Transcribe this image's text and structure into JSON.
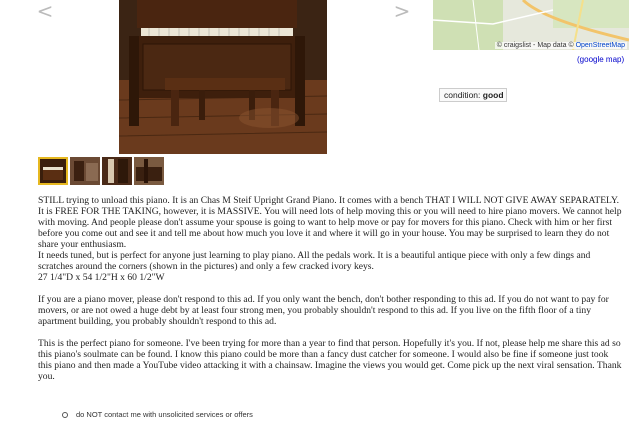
{
  "gallery": {
    "prev_arrow": "<",
    "next_arrow": ">",
    "thumbnail_count": 4
  },
  "map": {
    "attribution_prefix": "© craigslist - Map data © ",
    "attribution_link": "OpenStreetMap",
    "google_map_link": "(google map)"
  },
  "attributes": {
    "condition_label": "condition: ",
    "condition_value": "good"
  },
  "posting_body": [
    "STILL trying to unload this piano. It is an Chas M Steif Upright Grand Piano. It comes with a bench THAT I WILL NOT GIVE AWAY SEPARATELY.",
    "It is FREE FOR THE TAKING, however, it is MASSIVE. You will need lots of help moving this or you will need to hire piano movers. We cannot help with moving. And people please don't assume your spouse is going to want to help move or pay for movers for this piano. Check with him or her first before you come out and see it and tell me about how much you love it and where it will go in your house. You may be surprised to learn they do not share your enthusiasm.",
    "It needs tuned, but is perfect for anyone just learning to play piano. All the pedals work. It is a beautiful antique piece with only a few dings and scratches around the corners (shown in the pictures) and only a few cracked ivory keys.",
    "27 1/4\"D x 54 1/2\"H x 60 1/2\"W",
    "If you are a piano mover, please don't respond to this ad. If you only want the bench, don't bother responding to this ad. If you do not want to pay for movers, or are not owed a huge debt by at least four strong men, you probably shouldn't respond to this ad. If you live on the fifth floor of a tiny apartment building, you probably shouldn't respond to this ad.",
    "This is the perfect piano for someone. I've been trying for more than a year to find that person. Hopefully it's you. If not, please help me share this ad so this piano's soulmate can be found. I know this piano could be more than a fancy dust catcher for someone. I would also be fine if someone just took this piano and then made a YouTube video attacking it with a chainsaw. Imagine the views you would get. Come pick up the next viral sensation. Thank you."
  ],
  "notices": {
    "item1": "do NOT contact me with unsolicited services or offers"
  },
  "colors": {
    "link": "#0000cc",
    "thumb_highlight": "#e6b820"
  }
}
